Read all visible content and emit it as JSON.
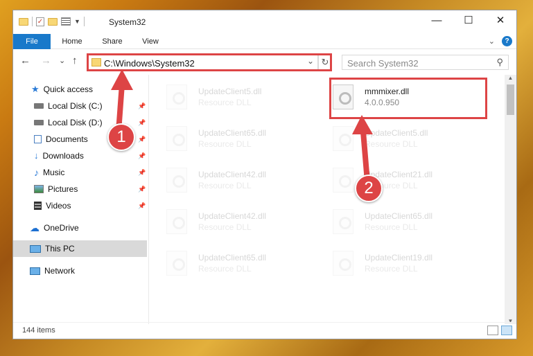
{
  "window": {
    "title": "System32",
    "controls": {
      "minimize": "—",
      "maximize": "☐",
      "close": "✕"
    }
  },
  "ribbon": {
    "tabs": [
      {
        "label": "File"
      },
      {
        "label": "Home"
      },
      {
        "label": "Share"
      },
      {
        "label": "View"
      }
    ],
    "expand_glyph": "⌄",
    "help_glyph": "?"
  },
  "navigation": {
    "back_glyph": "←",
    "forward_glyph": "→",
    "recent_glyph": "⌄",
    "up_glyph": "↑",
    "address": "C:\\Windows\\System32",
    "address_dropdown_glyph": "⌄",
    "refresh_glyph": "↻",
    "search_placeholder": "Search System32",
    "search_glyph": "⚲"
  },
  "sidebar": {
    "items": [
      {
        "label": "Quick access",
        "icon": "star-icon",
        "pinned": false
      },
      {
        "label": "Local Disk (C:)",
        "icon": "drive-icon",
        "pinned": true
      },
      {
        "label": "Local Disk (D:)",
        "icon": "drive-icon",
        "pinned": true
      },
      {
        "label": "Documents",
        "icon": "documents-icon",
        "pinned": true
      },
      {
        "label": "Downloads",
        "icon": "download-icon",
        "pinned": true
      },
      {
        "label": "Music",
        "icon": "music-icon",
        "pinned": true
      },
      {
        "label": "Pictures",
        "icon": "pictures-icon",
        "pinned": true
      },
      {
        "label": "Videos",
        "icon": "videos-icon",
        "pinned": true
      },
      {
        "label": "OneDrive",
        "icon": "cloud-icon",
        "pinned": false
      },
      {
        "label": "This PC",
        "icon": "computer-icon",
        "pinned": false,
        "selected": true
      },
      {
        "label": "Network",
        "icon": "network-icon",
        "pinned": false
      }
    ],
    "pin_glyph": "📌"
  },
  "files": [
    {
      "name": "UpdateClient5.dll",
      "desc": "Resource DLL",
      "faded": true
    },
    {
      "name": "mmmixer.dll",
      "desc": "4.0.0.950",
      "faded": false,
      "highlighted": true
    },
    {
      "name": "UpdateClient65.dll",
      "desc": "Resource DLL",
      "faded": true
    },
    {
      "name": "UpdateClient5.dll",
      "desc": "Resource DLL",
      "faded": true
    },
    {
      "name": "UpdateClient42.dll",
      "desc": "Resource DLL",
      "faded": true
    },
    {
      "name": "UpdateClient21.dll",
      "desc": "Resource DLL",
      "faded": true
    },
    {
      "name": "UpdateClient42.dll",
      "desc": "Resource DLL",
      "faded": true
    },
    {
      "name": "UpdateClient65.dll",
      "desc": "Resource DLL",
      "faded": true
    },
    {
      "name": "UpdateClient65.dll",
      "desc": "Resource DLL",
      "faded": true
    },
    {
      "name": "UpdateClient19.dll",
      "desc": "Resource DLL",
      "faded": true
    }
  ],
  "status": {
    "item_count": "144 items"
  },
  "callouts": [
    {
      "number": "1"
    },
    {
      "number": "2"
    }
  ],
  "colors": {
    "accent": "#1979ca",
    "highlight": "#dd4445"
  }
}
